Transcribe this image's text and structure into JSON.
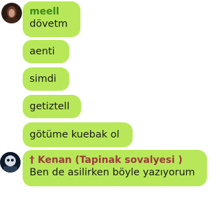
{
  "messages": [
    {
      "sender": "meell",
      "sender_color": "#3c8a1c",
      "lines": [
        "dövetm",
        "aenti",
        "simdi",
        "getiztell",
        "götüme kuebak ol"
      ]
    },
    {
      "sender": "† Kenan (Tapinak sovalyesi )",
      "sender_color": "#9c3a3a",
      "lines": [
        "Ben de asilirken böyle yazıyorum"
      ]
    }
  ],
  "bubble_color": "#b8e85a",
  "icons": [
    "user-avatar-meell-icon",
    "user-avatar-kenan-icon"
  ]
}
